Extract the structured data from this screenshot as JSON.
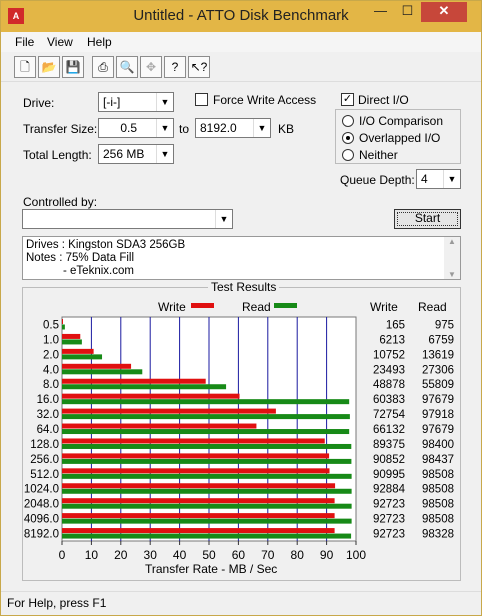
{
  "window": {
    "title": "Untitled - ATTO Disk Benchmark",
    "icon_text": "ATTO",
    "min": "—",
    "max": "☐",
    "close": "✕"
  },
  "menu": [
    {
      "label": "File"
    },
    {
      "label": "View"
    },
    {
      "label": "Help"
    }
  ],
  "toolbar": [
    "new-icon",
    "open-icon",
    "save-icon",
    "print-icon",
    "print-preview-icon",
    "move-icon",
    "help-icon",
    "context-help-icon"
  ],
  "form": {
    "drive_label": "Drive:",
    "drive_value": "[-i-]",
    "force_write_label": "Force Write Access",
    "force_write_checked": false,
    "direct_io_label": "Direct I/O",
    "direct_io_checked": true,
    "transfer_size_label": "Transfer Size:",
    "transfer_from": "0.5",
    "to_label": "to",
    "transfer_to": "8192.0",
    "kb_label": "KB",
    "total_length_label": "Total Length:",
    "total_length_value": "256 MB",
    "radio_io_comparison": "I/O Comparison",
    "radio_overlapped": "Overlapped I/O",
    "radio_neither": "Neither",
    "selected_radio": "Overlapped I/O",
    "queue_depth_label": "Queue Depth:",
    "queue_depth_value": "4",
    "controlled_by_label": "Controlled by:",
    "controlled_by_value": "",
    "start_label": "Start"
  },
  "notes": {
    "line1": "Drives : Kingston SDA3 256GB",
    "line2": "Notes : 75% Data Fill",
    "line3": "- eTeknix.com"
  },
  "results": {
    "group_title": "Test Results",
    "legend_write": "Write",
    "legend_read": "Read",
    "col_write": "Write",
    "col_read": "Read",
    "xlabel": "Transfer Rate - MB / Sec"
  },
  "chart_data": {
    "type": "bar",
    "orientation": "horizontal",
    "categories": [
      "0.5",
      "1.0",
      "2.0",
      "4.0",
      "8.0",
      "16.0",
      "32.0",
      "64.0",
      "128.0",
      "256.0",
      "512.0",
      "1024.0",
      "2048.0",
      "4096.0",
      "8192.0"
    ],
    "series": [
      {
        "name": "Write",
        "color": "#e01010",
        "values": [
          165,
          6213,
          10752,
          23493,
          48878,
          60383,
          72754,
          66132,
          89375,
          90852,
          90995,
          92884,
          92723,
          92723,
          92723
        ]
      },
      {
        "name": "Read",
        "color": "#178a17",
        "values": [
          975,
          6759,
          13619,
          27306,
          55809,
          97679,
          97918,
          97679,
          98400,
          98437,
          98508,
          98508,
          98508,
          98508,
          98328
        ]
      }
    ],
    "x_ticks": [
      "0",
      "10",
      "20",
      "30",
      "40",
      "50",
      "60",
      "70",
      "80",
      "90",
      "100"
    ],
    "xlabel": "Transfer Rate - MB / Sec",
    "xlim": [
      0,
      100
    ],
    "value_scale": "KB/s in table, bars in MB/s (value/1000)"
  },
  "status": {
    "text": "For Help, press F1"
  }
}
